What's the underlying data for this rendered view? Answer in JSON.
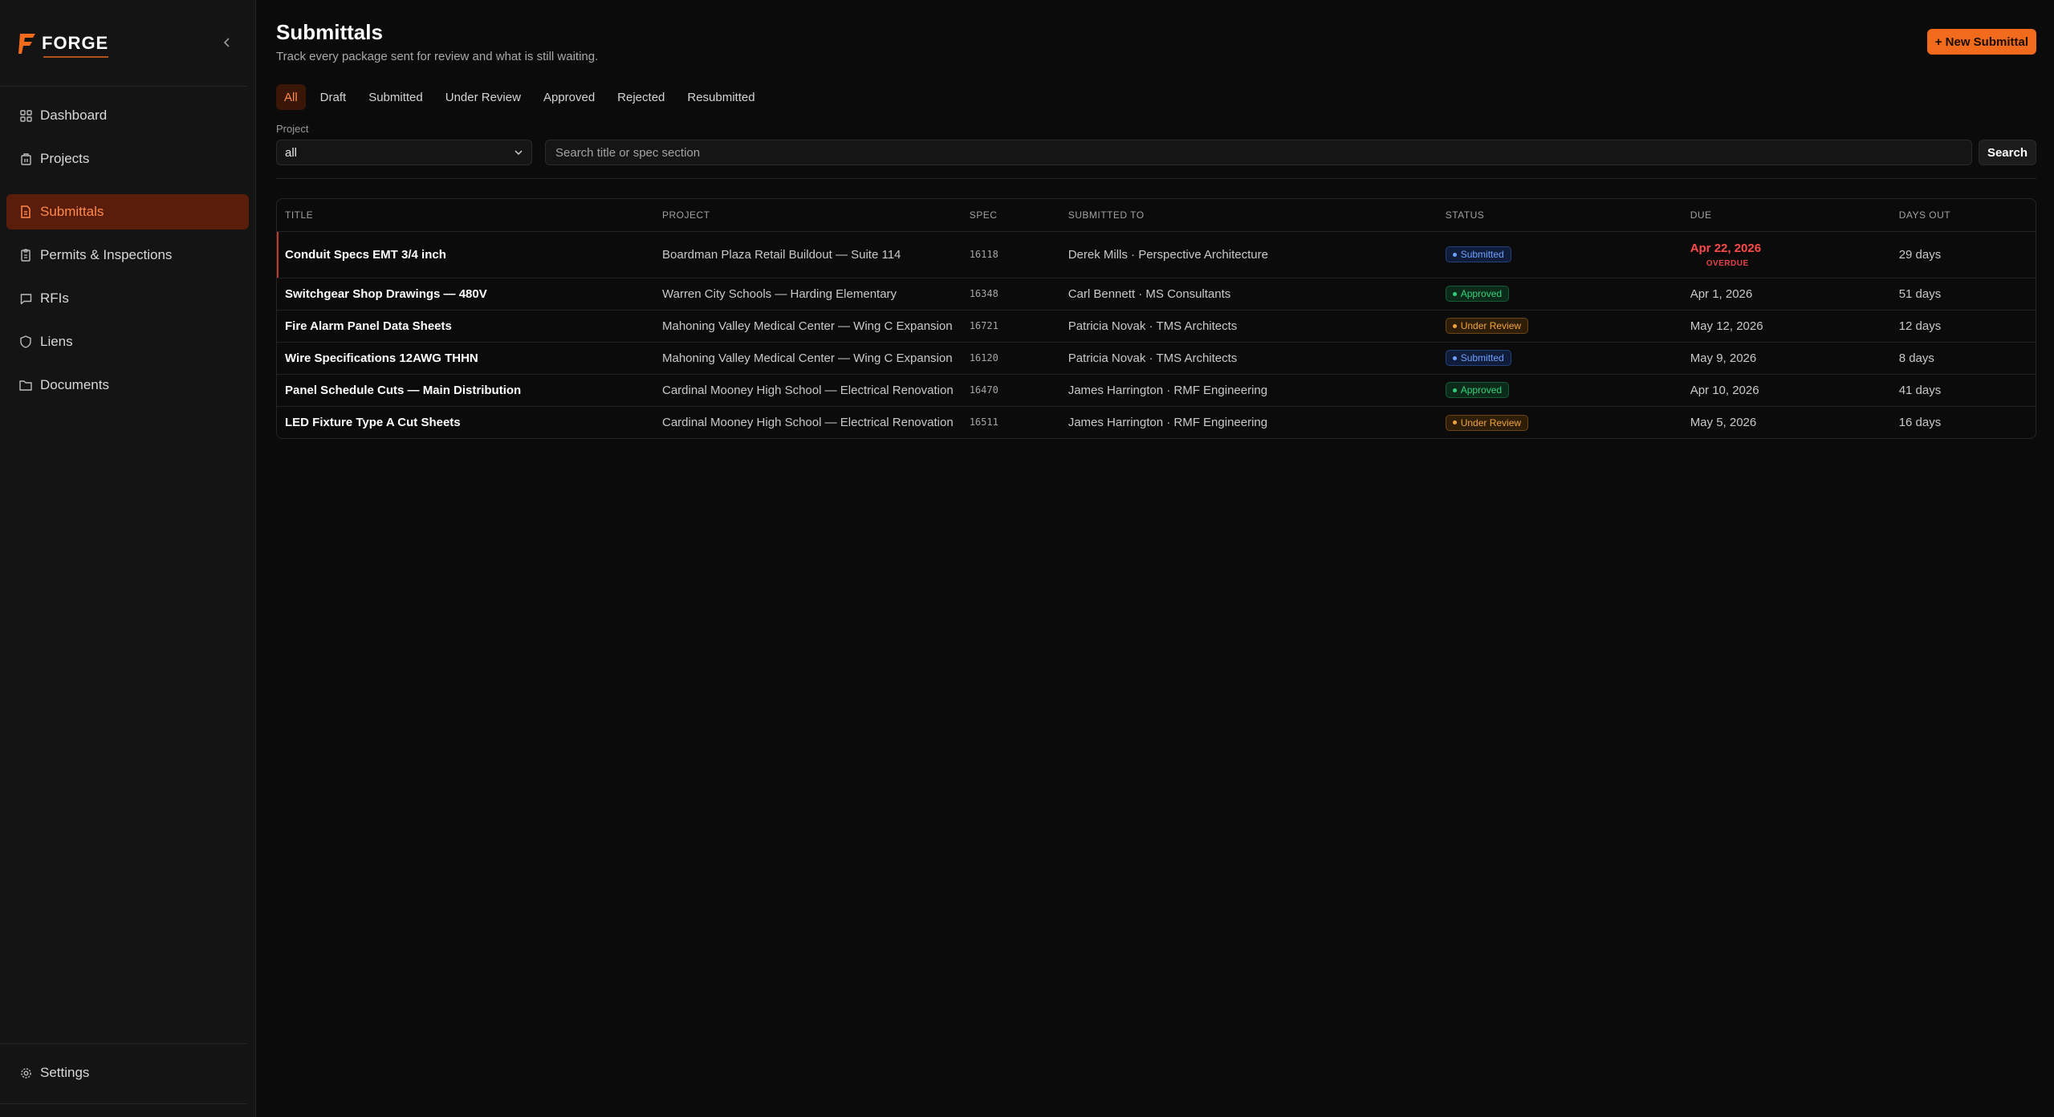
{
  "brand": {
    "name": "FORGE",
    "accent": "#f26b1d"
  },
  "sidebar": {
    "items": [
      {
        "label": "Dashboard",
        "icon": "grid-icon"
      },
      {
        "label": "Projects",
        "icon": "building-icon"
      },
      {
        "label": "Submittals",
        "icon": "document-icon",
        "active": true
      },
      {
        "label": "Permits & Inspections",
        "icon": "clipboard-icon"
      },
      {
        "label": "RFIs",
        "icon": "chat-icon"
      },
      {
        "label": "Liens",
        "icon": "shield-icon"
      },
      {
        "label": "Documents",
        "icon": "folder-icon"
      }
    ],
    "settings": {
      "label": "Settings",
      "icon": "gear-icon"
    }
  },
  "header": {
    "title": "Submittals",
    "subtitle": "Track every package sent for review and what is still waiting.",
    "new_button": "+ New Submittal"
  },
  "tabs": [
    {
      "label": "All",
      "active": true
    },
    {
      "label": "Draft"
    },
    {
      "label": "Submitted"
    },
    {
      "label": "Under Review"
    },
    {
      "label": "Approved"
    },
    {
      "label": "Rejected"
    },
    {
      "label": "Resubmitted"
    }
  ],
  "filters": {
    "project_label": "Project",
    "project_value": "all",
    "search_placeholder": "Search title or spec section",
    "search_button": "Search"
  },
  "table": {
    "headers": {
      "title": "TITLE",
      "project": "PROJECT",
      "spec": "SPEC",
      "submitted_to": "SUBMITTED TO",
      "status": "STATUS",
      "due": "DUE",
      "days_out": "DAYS OUT"
    },
    "rows": [
      {
        "title": "Conduit Specs EMT 3/4 inch",
        "project": "Boardman Plaza Retail Buildout — Suite 114",
        "spec": "16118",
        "submitted_to": "Derek Mills · Perspective Architecture",
        "status": "Submitted",
        "due": "Apr 22, 2026",
        "overdue": "OVERDUE",
        "days_out": "29 days"
      },
      {
        "title": "Switchgear Shop Drawings — 480V",
        "project": "Warren City Schools — Harding Elementary",
        "spec": "16348",
        "submitted_to": "Carl Bennett · MS Consultants",
        "status": "Approved",
        "due": "Apr 1, 2026",
        "days_out": "51 days"
      },
      {
        "title": "Fire Alarm Panel Data Sheets",
        "project": "Mahoning Valley Medical Center — Wing C Expansion",
        "spec": "16721",
        "submitted_to": "Patricia Novak · TMS Architects",
        "status": "Under Review",
        "due": "May 12, 2026",
        "days_out": "12 days"
      },
      {
        "title": "Wire Specifications 12AWG THHN",
        "project": "Mahoning Valley Medical Center — Wing C Expansion",
        "spec": "16120",
        "submitted_to": "Patricia Novak · TMS Architects",
        "status": "Submitted",
        "due": "May 9, 2026",
        "days_out": "8 days"
      },
      {
        "title": "Panel Schedule Cuts — Main Distribution",
        "project": "Cardinal Mooney High School — Electrical Renovation",
        "spec": "16470",
        "submitted_to": "James Harrington · RMF Engineering",
        "status": "Approved",
        "due": "Apr 10, 2026",
        "days_out": "41 days"
      },
      {
        "title": "LED Fixture Type A Cut Sheets",
        "project": "Cardinal Mooney High School — Electrical Renovation",
        "spec": "16511",
        "submitted_to": "James Harrington · RMF Engineering",
        "status": "Under Review",
        "due": "May 5, 2026",
        "days_out": "16 days"
      }
    ]
  }
}
